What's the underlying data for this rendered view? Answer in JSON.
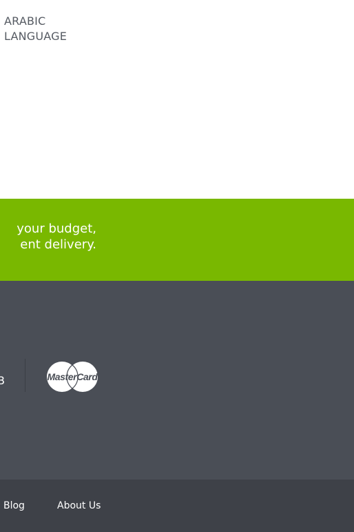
{
  "header": {
    "language_link": "ARABIC LANGUAGE"
  },
  "banner": {
    "line1": "your budget,",
    "line2": "ent delivery.",
    "background": "#79b800"
  },
  "payment": {
    "cut_text": "В",
    "logo_text": "MasterCard",
    "logo_icon": "mastercard-icon"
  },
  "footer": {
    "links": [
      {
        "label": "Blog"
      },
      {
        "label": "About Us"
      }
    ]
  },
  "colors": {
    "top_bg": "#ffffff",
    "banner_bg": "#79b800",
    "payment_bg": "#4a4e56",
    "footer_bg": "#3e4148",
    "text_light": "#ffffff",
    "text_dark": "#555a62"
  }
}
